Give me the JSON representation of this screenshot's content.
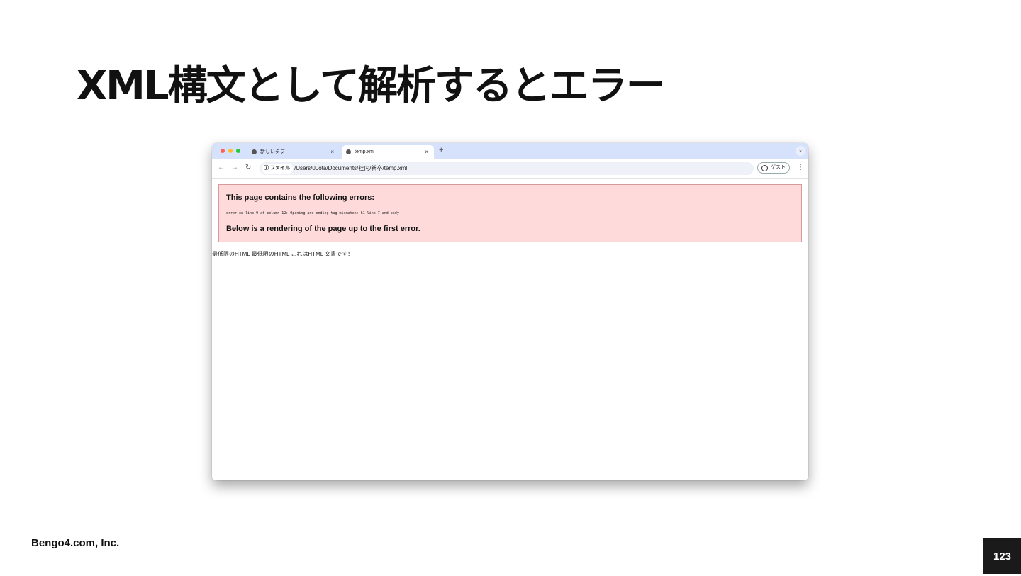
{
  "slide": {
    "title": "XML構文として解析するとエラー",
    "footer_company": "Bengo4.com, Inc.",
    "page_number": "123"
  },
  "browser": {
    "tabs": [
      {
        "label": "新しいタブ",
        "active": false,
        "icon": "globe-icon"
      },
      {
        "label": "temp.xml",
        "active": true,
        "icon": "globe-icon"
      }
    ],
    "new_tab_glyph": "+",
    "tab_menu_glyph": "⌄",
    "close_glyph": "×",
    "omnibox": {
      "chip_label": "ファイル",
      "url": "/Users/00ota/Documents/社内/新卒/temp.xml"
    },
    "profile_label": "ゲスト",
    "menu_glyph": "⋮"
  },
  "page": {
    "error_heading": "This page contains the following errors:",
    "error_detail": "error on line 9 at column 12: Opening and ending tag mismatch: h1 line 7 and body",
    "render_heading": "Below is a rendering of the page up to the first error.",
    "rendered_text": "最低限のHTML 最低限のHTML これはHTML 文書です！"
  },
  "colors": {
    "error_bg": "#fedada",
    "error_border": "#d69a9a",
    "tabbar_bg": "#d6e2fb"
  }
}
